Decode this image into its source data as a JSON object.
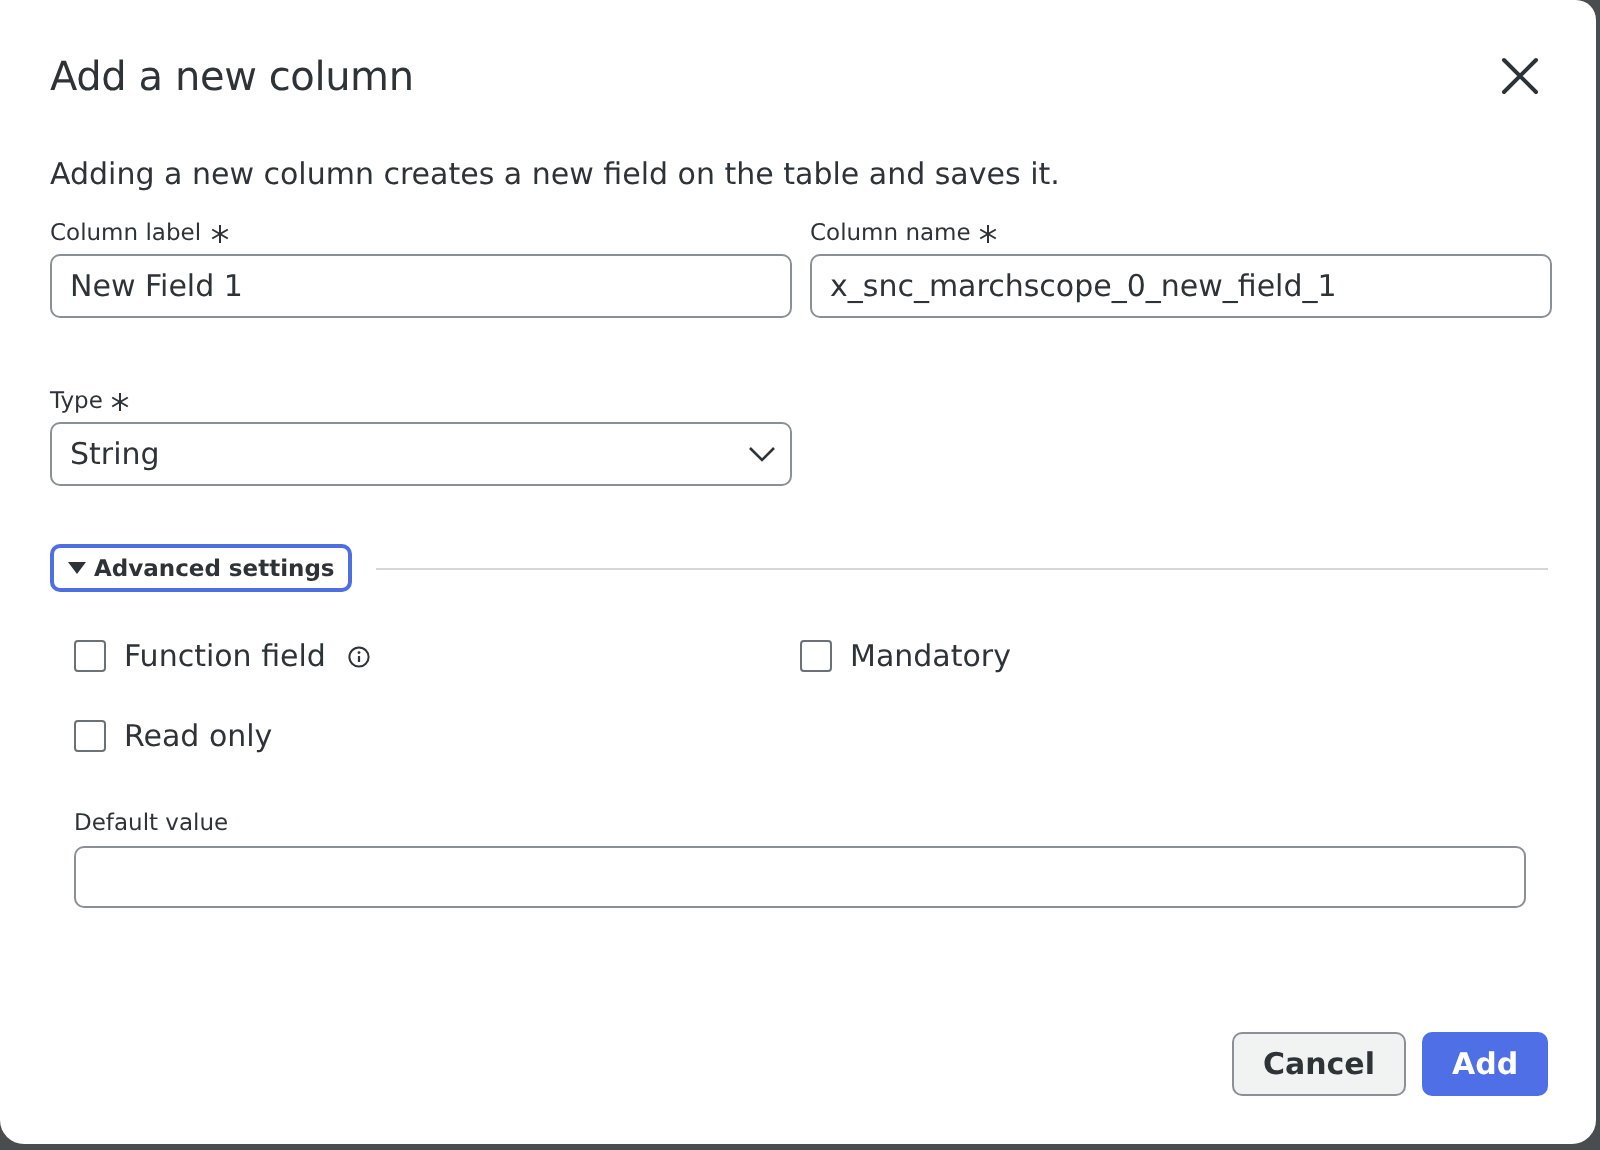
{
  "dialog": {
    "title": "Add a new column",
    "description": "Adding a new column creates a new field on the table and saves it."
  },
  "fields": [
    {
      "label": "Column label",
      "required": true,
      "value": "New Field 1",
      "kind": "text"
    },
    {
      "label": "Column name",
      "required": true,
      "value": "x_snc_marchscope_0_new_field_1",
      "kind": "text"
    },
    {
      "label": "Type",
      "required": true,
      "value": "String",
      "kind": "select"
    }
  ],
  "advanced": {
    "label": "Advanced settings",
    "expanded": true,
    "checkboxes": [
      {
        "label": "Function field",
        "checked": false,
        "info": true
      },
      {
        "label": "Mandatory",
        "checked": false,
        "info": false
      },
      {
        "label": "Read only",
        "checked": false,
        "info": false
      }
    ],
    "default_value": {
      "label": "Default value"
    }
  },
  "buttons": [
    {
      "label": "Cancel",
      "kind": "secondary"
    },
    {
      "label": "Add",
      "kind": "primary"
    }
  ]
}
